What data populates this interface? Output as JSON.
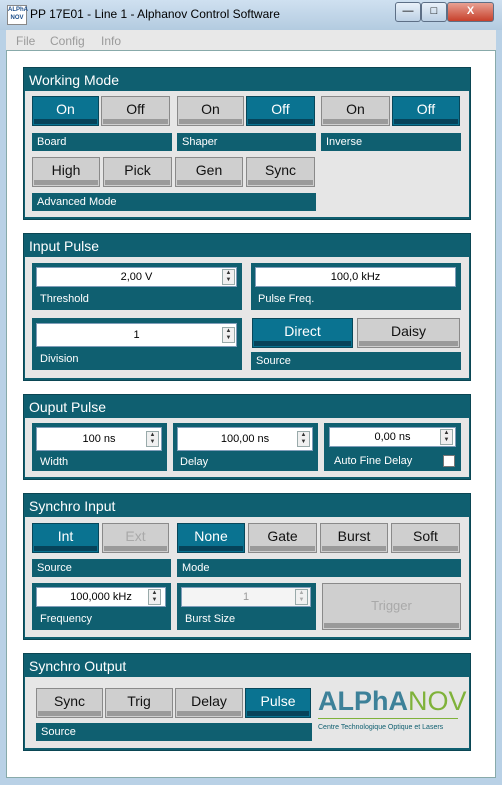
{
  "window": {
    "app_icon_text": "ALPhA NOV",
    "title": "PP 17E01 - Line 1 - Alphanov Control Software",
    "minimize": "—",
    "maximize": "□",
    "close": "X"
  },
  "menu": [
    "File",
    "Config",
    "Info"
  ],
  "working_mode": {
    "title": "Working Mode",
    "board": {
      "label": "Board",
      "on": "On",
      "off": "Off",
      "selected": "On"
    },
    "shaper": {
      "label": "Shaper",
      "on": "On",
      "off": "Off",
      "selected": "Off"
    },
    "inverse": {
      "label": "Inverse",
      "on": "On",
      "off": "Off",
      "selected": "Off"
    },
    "advanced": {
      "label": "Advanced Mode",
      "buttons": [
        "High",
        "Pick",
        "Gen",
        "Sync"
      ]
    }
  },
  "input_pulse": {
    "title": "Input Pulse",
    "threshold": {
      "label": "Threshold",
      "value": "2,00 V"
    },
    "pulse_freq": {
      "label": "Pulse Freq.",
      "value": "100,0 kHz"
    },
    "division": {
      "label": "Division",
      "value": "1"
    },
    "source": {
      "label": "Source",
      "options": [
        "Direct",
        "Daisy"
      ],
      "selected": "Direct"
    }
  },
  "output_pulse": {
    "title": "Ouput Pulse",
    "width": {
      "label": "Width",
      "value": "100 ns"
    },
    "delay": {
      "label": "Delay",
      "value": "100,00 ns"
    },
    "auto_fine_delay": {
      "label": "Auto Fine Delay",
      "value": "0,00 ns",
      "checked": false
    }
  },
  "synchro_input": {
    "title": "Synchro Input",
    "source": {
      "label": "Source",
      "options": [
        "Int",
        "Ext"
      ],
      "selected": "Int"
    },
    "mode": {
      "label": "Mode",
      "options": [
        "None",
        "Gate",
        "Burst",
        "Soft"
      ],
      "selected": "None"
    },
    "frequency": {
      "label": "Frequency",
      "value": "100,000 kHz"
    },
    "burst_size": {
      "label": "Burst Size",
      "value": "1"
    },
    "trigger": "Trigger"
  },
  "synchro_output": {
    "title": "Synchro Output",
    "source": {
      "label": "Source",
      "options": [
        "Sync",
        "Trig",
        "Delay",
        "Pulse"
      ],
      "selected": "Pulse"
    }
  },
  "logo": {
    "name_left": "ALPhA",
    "name_right": "NOV",
    "tagline": "Centre Technologique Optique et Lasers"
  },
  "colors": {
    "panel": "#0f5f70",
    "active_button": "#0a7391",
    "inactive_button": "#cfcfcf"
  }
}
